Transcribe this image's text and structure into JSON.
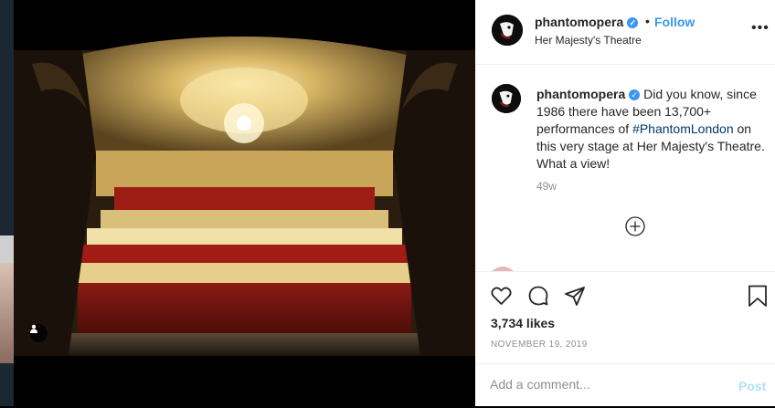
{
  "post": {
    "username": "phantomopera",
    "verified_icon": "verified-badge-icon",
    "separator": "•",
    "follow_label": "Follow",
    "location": "Her Majesty's Theatre",
    "more_label": "•••",
    "caption_text_1": "Did you know, since 1986 there have been 13,700+ performances of ",
    "caption_hashtag": "#PhantomLondon",
    "caption_text_2": " on this very stage at Her Majesty's Theatre. What a view!",
    "age": "49w",
    "likes": "3,734 likes",
    "date": "NOVEMBER 19, 2019",
    "comment_placeholder": "Add a comment...",
    "post_label": "Post"
  },
  "colors": {
    "accent": "#3897f0",
    "post_disabled": "#b2dffc",
    "muted": "#8e8e8e",
    "text": "#262626"
  },
  "icons": [
    "heart-icon",
    "comment-icon",
    "share-icon",
    "bookmark-icon",
    "add-icon",
    "user-tag-icon",
    "more-icon"
  ]
}
